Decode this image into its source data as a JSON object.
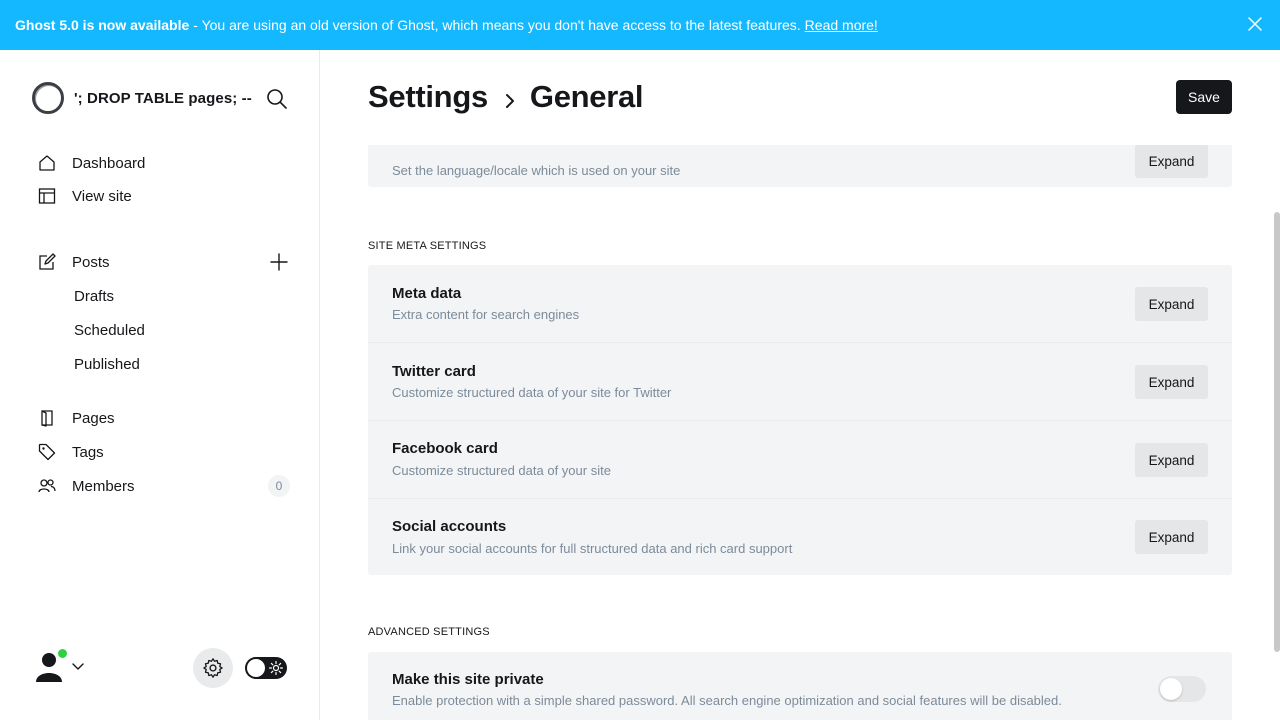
{
  "banner": {
    "title": "Ghost 5.0 is now available",
    "message": "- You are using an old version of Ghost, which means you don't have access to the latest features.",
    "link": "Read more!"
  },
  "sidebar": {
    "site_name": "'; DROP TABLE pages; --",
    "nav": [
      {
        "label": "Dashboard",
        "icon": "home-icon"
      },
      {
        "label": "View site",
        "icon": "layout-icon"
      }
    ],
    "posts": {
      "label": "Posts",
      "icon": "edit-icon",
      "sub": [
        "Drafts",
        "Scheduled",
        "Published"
      ]
    },
    "other": [
      {
        "label": "Pages",
        "icon": "page-icon"
      },
      {
        "label": "Tags",
        "icon": "tag-icon"
      },
      {
        "label": "Members",
        "icon": "members-icon",
        "count": "0"
      }
    ]
  },
  "header": {
    "breadcrumb_parent": "Settings",
    "breadcrumb_current": "General",
    "save_label": "Save"
  },
  "language_row": {
    "desc": "Set the language/locale which is used on your site",
    "button": "Expand"
  },
  "meta_section": {
    "title": "SITE META SETTINGS",
    "rows": [
      {
        "title": "Meta data",
        "desc": "Extra content for search engines",
        "button": "Expand"
      },
      {
        "title": "Twitter card",
        "desc": "Customize structured data of your site for Twitter",
        "button": "Expand"
      },
      {
        "title": "Facebook card",
        "desc": "Customize structured data of your site",
        "button": "Expand"
      },
      {
        "title": "Social accounts",
        "desc": "Link your social accounts for full structured data and rich card support",
        "button": "Expand"
      }
    ]
  },
  "advanced_section": {
    "title": "ADVANCED SETTINGS",
    "private": {
      "title": "Make this site private",
      "desc": "Enable protection with a simple shared password. All search engine optimization and social features will be disabled.",
      "enabled": false
    }
  },
  "colors": {
    "banner": "#14b8ff",
    "primary_button": "#15171a",
    "online": "#30cf43"
  }
}
